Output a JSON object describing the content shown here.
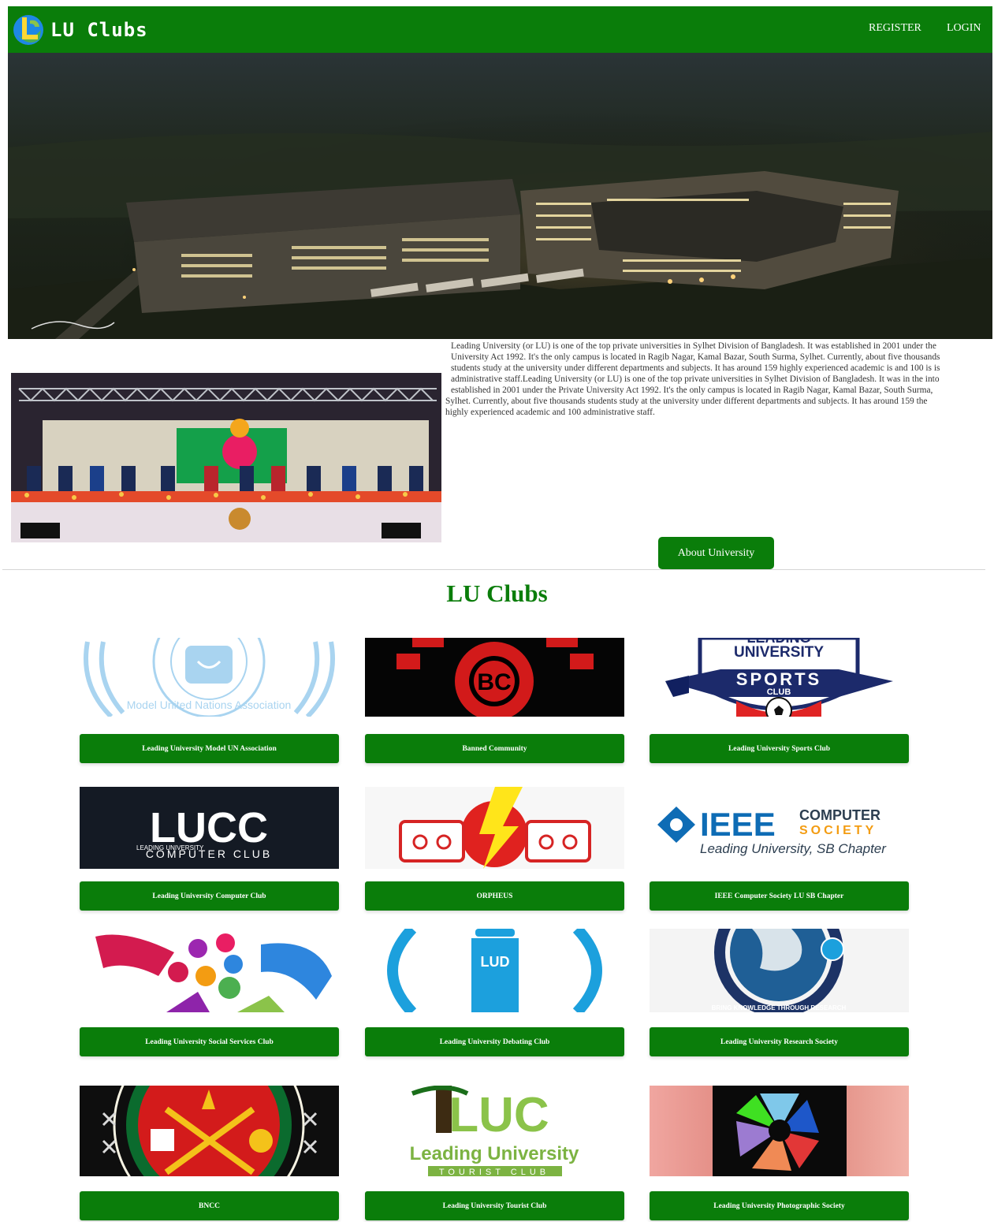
{
  "nav": {
    "brand": "LU Clubs",
    "register": "REGISTER",
    "login": "LOGIN"
  },
  "about": {
    "paragraph_lines": [
      "Leading University (or LU) is one of the top private universities in Sylhet Division of Bangladesh. It was established in 2001 under the",
      "University Act 1992. It's the only campus is located in Ragib Nagar, Kamal Bazar, South Surma, Sylhet. Currently, about five thousands",
      "students study at the university under different departments and subjects. It has around 159 highly experienced academic is and 100 is is",
      "administrative staff.Leading University (or LU) is one of the top private universities in Sylhet Division of Bangladesh. It was in the into",
      "established in 2001 under the Private University Act 1992. It's the only campus is located in Ragib Nagar, Kamal Bazar, South Surma,",
      "Sylhet. Currently, about five thousands students study at the university under different departments and subjects. It has around 159 the",
      "highly experienced academic and 100 administrative staff."
    ],
    "button": "About University"
  },
  "clubs_section": {
    "title": "LU Clubs",
    "clubs": [
      {
        "name": "Leading University Model UN Association"
      },
      {
        "name": "Banned Community"
      },
      {
        "name": "Leading University Sports Club"
      },
      {
        "name": "Leading University Computer Club"
      },
      {
        "name": "ORPHEUS"
      },
      {
        "name": "IEEE Computer Society LU SB Chapter"
      },
      {
        "name": "Leading University Social Services Club"
      },
      {
        "name": "Leading University Debating Club"
      },
      {
        "name": "Leading University Research Society"
      },
      {
        "name": "BNCC"
      },
      {
        "name": "Leading University Tourist Club"
      },
      {
        "name": "Leading University Photographic Society"
      }
    ]
  },
  "logo_text": {
    "model_un": "Model United Nations Association",
    "banned": "BC",
    "sports_top": "LEADING",
    "sports_mid": "UNIVERSITY",
    "sports_ribbon": "SPORTS",
    "sports_club": "CLUB",
    "lucc": "LUCC",
    "lucc_small": "LEADING UNIVERSITY",
    "lucc_sub": "COMPUTER CLUB",
    "ieee": "IEEE",
    "ieee_computer": "COMPUTER",
    "ieee_society": "SOCIETY",
    "ieee_chapter": "Leading University, SB Chapter",
    "debate": "LUD",
    "research_ring": "BRING KNOWLEDGE THROUGH RESEARCH",
    "tourist_big": "Leading University",
    "tourist_small": "TOURIST CLUB",
    "tourist_mark": "LUC"
  },
  "colors": {
    "primary_green": "#0a7d0a",
    "text": "#333333"
  }
}
